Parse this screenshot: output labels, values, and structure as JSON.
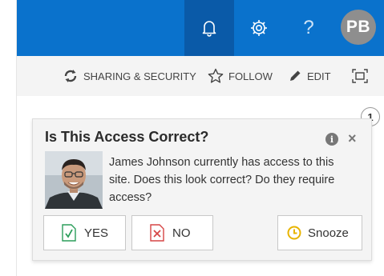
{
  "header": {
    "avatar_initials": "PB",
    "help_label": "?",
    "accent_color": "#0a72cc",
    "active_cell_color": "#0a5aa8"
  },
  "actions": {
    "sharing": "SHARING & SECURITY",
    "follow": "FOLLOW",
    "edit": "EDIT"
  },
  "notification": {
    "count": "1",
    "title": "Is This Access Correct?",
    "info_label": "i",
    "close_label": "×",
    "message": "James Johnson currently has access to this site. Does this look correct? Do they require access?",
    "buttons": {
      "yes": "YES",
      "no": "NO",
      "snooze": "Snooze"
    }
  },
  "icons": [
    "bell-icon",
    "gear-icon",
    "help-icon",
    "sync-icon",
    "star-icon",
    "pencil-icon",
    "focus-icon",
    "info-icon",
    "close-icon",
    "check-icon",
    "x-icon",
    "clock-icon"
  ]
}
